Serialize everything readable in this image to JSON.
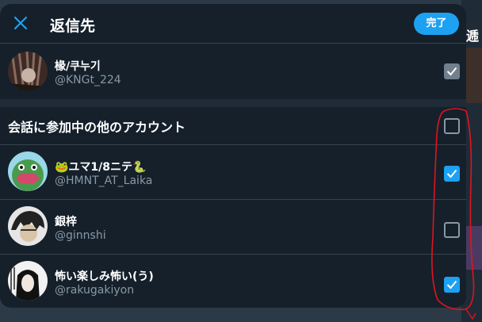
{
  "dialog": {
    "title": "返信先",
    "done_label": "完了",
    "section_title": "会話に参加中の他のアカウント"
  },
  "background": {
    "glyph": "逓"
  },
  "accounts": [
    {
      "name": "椽/쿠누기",
      "handle": "@KNGt_224",
      "checked": true,
      "checkbox_state": "checked-disabled"
    },
    {
      "name": "🐸ユマ1/8ニテ🐍",
      "handle": "@HMNT_AT_Laika",
      "checked": true,
      "checkbox_state": "checked"
    },
    {
      "name": "銀梓",
      "handle": "@ginnshi",
      "checked": false,
      "checkbox_state": "unchecked"
    },
    {
      "name": "怖い楽しみ怖い(う)",
      "handle": "@rakugakiyon",
      "checked": true,
      "checkbox_state": "checked"
    }
  ],
  "section_checkbox": {
    "checked": false
  },
  "colors": {
    "accent": "#1da1f2",
    "background": "#15202b",
    "secondary_text": "#8899a6",
    "annotation": "#e0141e"
  }
}
